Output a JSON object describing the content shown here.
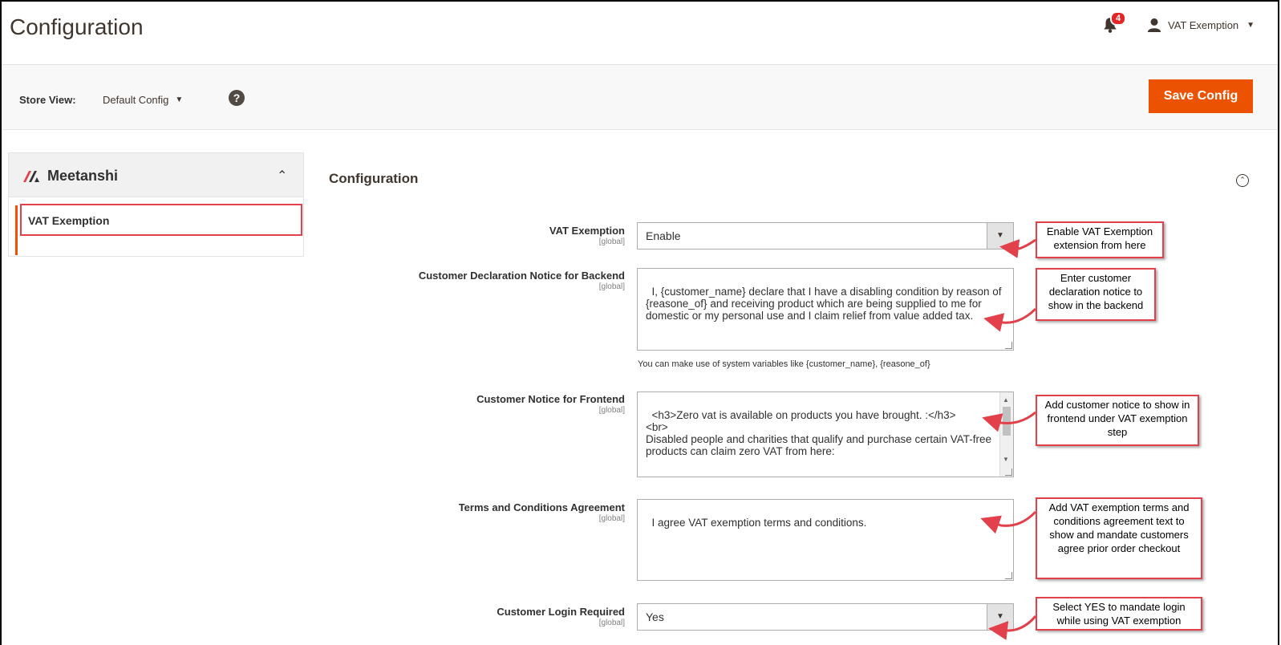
{
  "header": {
    "title": "Configuration",
    "notification_count": "4",
    "user_name": "VAT Exemption"
  },
  "toolbar": {
    "store_view_label": "Store View:",
    "store_view_value": "Default Config",
    "help_label": "?",
    "save_label": "Save Config"
  },
  "sidebar": {
    "group_label": "Meetanshi",
    "items": [
      {
        "label": "VAT Exemption"
      }
    ]
  },
  "section": {
    "title": "Configuration"
  },
  "fields": {
    "vat_exemption": {
      "label": "VAT Exemption",
      "scope": "[global]",
      "value": "Enable"
    },
    "backend_notice": {
      "label": "Customer Declaration Notice for Backend",
      "scope": "[global]",
      "value": "I, {customer_name} declare that I have a disabling condition by reason of {reasone_of} and receiving product which are being supplied to me for domestic or my personal use and I claim relief from value added tax.",
      "note": "You can make use of system variables like {customer_name}, {reasone_of}"
    },
    "frontend_notice": {
      "label": "Customer Notice for Frontend",
      "scope": "[global]",
      "value": "<h3>Zero vat is available on products you have brought. :</h3>\n<br>\nDisabled people and charities that qualify and purchase certain VAT-free products can claim zero VAT from here:"
    },
    "terms": {
      "label": "Terms and Conditions Agreement",
      "scope": "[global]",
      "value": "I agree VAT exemption terms and conditions."
    },
    "login_required": {
      "label": "Customer Login Required",
      "scope": "[global]",
      "value": "Yes"
    }
  },
  "callouts": {
    "c1": "Enable VAT Exemption extension from here",
    "c2": "Enter customer declaration notice to show in the backend",
    "c3": "Add customer notice to show in frontend under VAT exemption step",
    "c4": "Add VAT exemption terms and conditions agreement text to show and mandate customers agree prior order checkout",
    "c5": "Select YES to mandate login while using VAT exemption"
  },
  "colors": {
    "accent": "#eb5202",
    "callout_border": "#e2404a",
    "badge": "#e22626"
  }
}
